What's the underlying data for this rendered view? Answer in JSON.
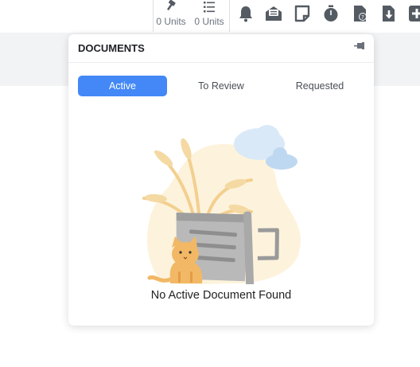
{
  "toolbar": {
    "units": [
      {
        "icon": "gavel-icon",
        "label": "0 Units"
      },
      {
        "icon": "list-icon",
        "label": "0 Units"
      }
    ],
    "icons": [
      "bell-icon",
      "envelope-open-icon",
      "sticky-note-icon",
      "stopwatch-icon",
      "file-question-icon",
      "file-download-icon",
      "plus-square-icon"
    ],
    "icon_color": "#555b63"
  },
  "documents_panel": {
    "title": "DOCUMENTS",
    "tabs": [
      {
        "label": "Active",
        "active": true
      },
      {
        "label": "To Review",
        "active": false
      },
      {
        "label": "Requested",
        "active": false
      }
    ],
    "accent": "#4388f6",
    "empty_message": "No Active Document Found",
    "illustration": "cat-with-trash-can-icon"
  }
}
